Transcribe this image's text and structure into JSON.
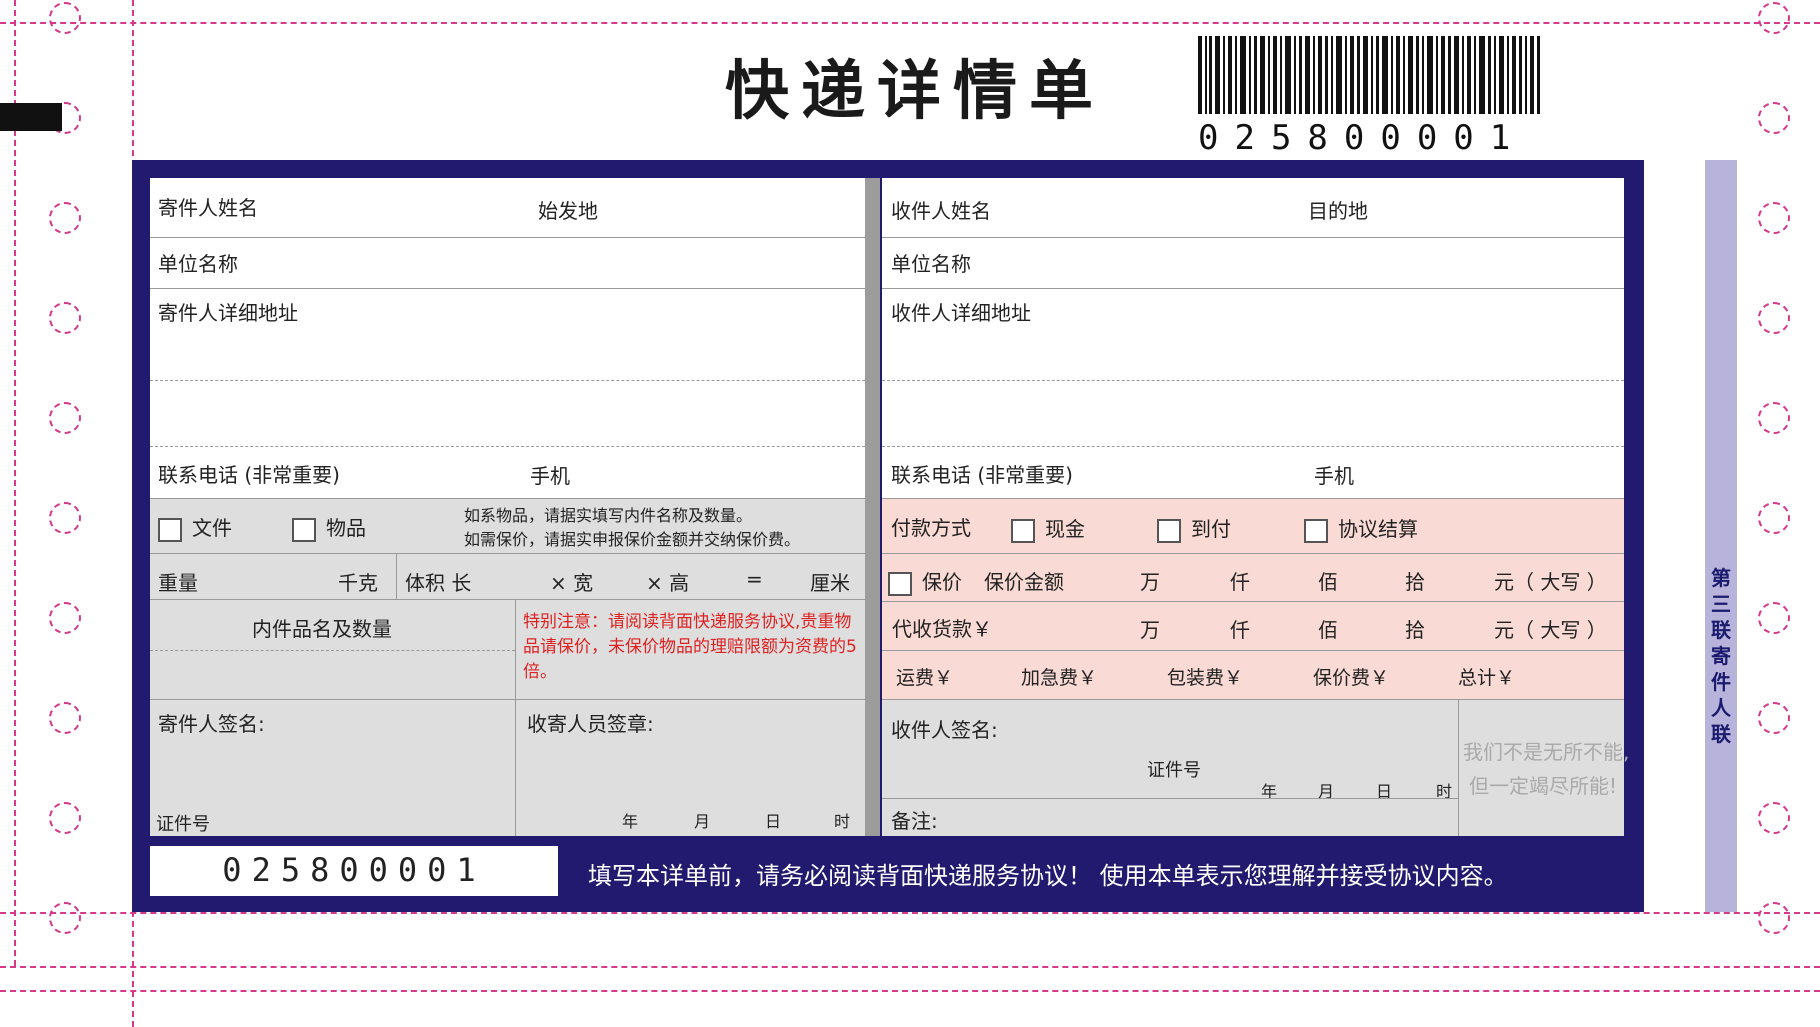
{
  "title": "快递详情单",
  "tracking_number": "025800001",
  "sender": {
    "name_label": "寄件人姓名",
    "origin_label": "始发地",
    "company_label": "单位名称",
    "address_label": "寄件人详细地址",
    "phone_label": "联系电话 (非常重要)",
    "mobile_label": "手机",
    "doc_label": "文件",
    "goods_label": "物品",
    "hint_line1": "如系物品，请据实填写内件名称及数量。",
    "hint_line2": "如需保价，请据实申报保价金额并交纳保价费。",
    "weight_label": "重量",
    "kg_label": "千克",
    "volume_label": "体积  长",
    "width_label": "× 宽",
    "height_label": "× 高",
    "equals_label": "=",
    "cm_label": "厘米",
    "contents_label": "内件品名及数量",
    "special_notice": "特别注意：请阅读背面快递服务协议,贵重物品请保价，未保价物品的理赔限额为资费的5倍。",
    "signature_label": "寄件人签名:",
    "id_label": "证件号",
    "courier_sign_label": "收寄人员签章:",
    "year": "年",
    "month": "月",
    "day": "日",
    "hour": "时"
  },
  "receiver": {
    "name_label": "收件人姓名",
    "dest_label": "目的地",
    "company_label": "单位名称",
    "address_label": "收件人详细地址",
    "phone_label": "联系电话 (非常重要)",
    "mobile_label": "手机",
    "payment_label": "付款方式",
    "cash_label": "现金",
    "cod_label": "到付",
    "agreement_label": "协议结算",
    "insure_label": "保价",
    "insure_amount_label": "保价金额",
    "collect_label": "代收货款￥",
    "wan": "万",
    "qian": "仟",
    "bai": "佰",
    "shi": "拾",
    "yuan": "元（ 大写 ）",
    "freight_label": "运费￥",
    "urgent_label": "加急费￥",
    "packing_label": "包装费￥",
    "insure_fee_label": "保价费￥",
    "total_label": "总计￥",
    "signature_label": "收件人签名:",
    "id_label": "证件号",
    "year": "年",
    "month": "月",
    "day": "日",
    "hour": "时",
    "remark_label": "备注:",
    "motto_line1": "我们不是无所不能,",
    "motto_line2": "但一定竭尽所能!"
  },
  "side_label": "第三联  寄件人联",
  "footer_notice": "填写本详单前，请务必阅读背面快递服务协议！ 使用本单表示您理解并接受协议内容。"
}
